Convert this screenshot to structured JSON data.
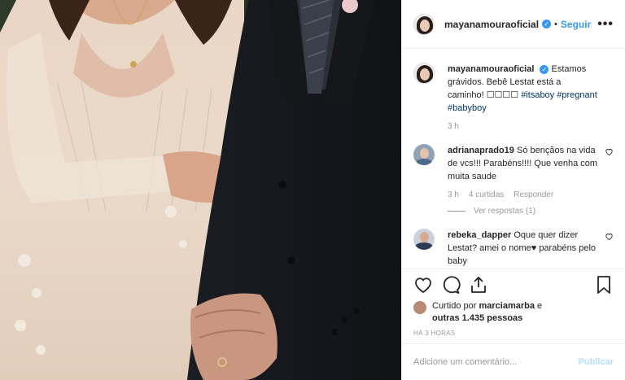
{
  "post": {
    "image_alt": "",
    "header": {
      "username": "mayanamouraoficial",
      "separator": "•",
      "follow_label": "Seguir",
      "more_label": "•••"
    },
    "caption": {
      "username": "mayanamouraoficial",
      "text": "Estamos grávidos. Bebê Lestat está a caminho! ☐☐☐☐",
      "hashtags": [
        "#itsaboy",
        "#pregnant",
        "#babyboy"
      ],
      "time": "3 h"
    },
    "comments": [
      {
        "username": "adrianaprado19",
        "text": "Só bençãos na vida de vcs!!! Parabéns!!!! Que venha com muita saude",
        "time": "3 h",
        "likes": "4 curtidas",
        "reply_label": "Responder",
        "view_replies": "Ver respostas (1)"
      },
      {
        "username": "rebeka_dapper",
        "text": "Oque quer dizer Lestat? amei o nome♥ parabéns pelo baby"
      }
    ],
    "liked_by": {
      "prefix": "Curtido por",
      "user": "marciamarba",
      "conjunction": "e",
      "others": "outras 1.435 pessoas"
    },
    "timestamp": "HÁ 3 HORAS",
    "add_comment": {
      "placeholder": "Adicione um comentário...",
      "publish_label": "Publicar"
    }
  },
  "colors": {
    "accent": "#3897f0",
    "muted": "#999999",
    "hashtag": "#003569"
  }
}
